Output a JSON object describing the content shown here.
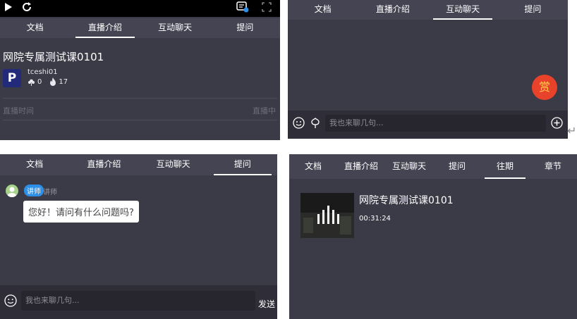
{
  "panel1": {
    "tabs": [
      "文档",
      "直播介绍",
      "互动聊天",
      "提问"
    ],
    "active_tab": 1,
    "course_title": "网院专属测试课0101",
    "avatar_letter": "P",
    "teacher": "tceshi01",
    "likes": "0",
    "popularity": "17",
    "live_time_label": "直播时间",
    "live_status": "直播中"
  },
  "panel2": {
    "tabs": [
      "文档",
      "直播介绍",
      "互动聊天",
      "提问"
    ],
    "active_tab": 2,
    "reward_label": "赏",
    "chat_placeholder": "我也来聊几句...",
    "return_glyph": "↵"
  },
  "panel3": {
    "tabs": [
      "文档",
      "直播介绍",
      "互动聊天",
      "提问"
    ],
    "active_tab": 3,
    "badge": "讲师",
    "role": "讲师",
    "message": "您好！请问有什么问题吗?",
    "input_placeholder": "我也来聊几句...",
    "send_label": "发送"
  },
  "panel4": {
    "tabs": [
      "文档",
      "直播介绍",
      "互动聊天",
      "提问",
      "往期",
      "章节"
    ],
    "active_tab": 4,
    "video_title": "网院专属测试课0101",
    "duration": "00:31:24"
  },
  "colors": {
    "panel_bg": "#3b3a47",
    "tab_bar": "#454452",
    "input_bg": "#27262e",
    "reward": "#e8422b",
    "badge": "#2f8fe6"
  }
}
